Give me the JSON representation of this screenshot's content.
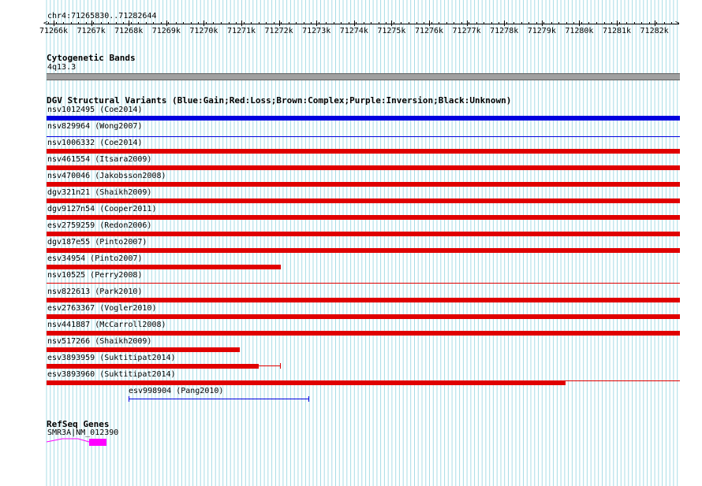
{
  "ruler": {
    "position_label": "chr4:71265830..71282644",
    "ticks": [
      "71266k",
      "71267k",
      "71268k",
      "71269k",
      "71270k",
      "71271k",
      "71272k",
      "71273k",
      "71274k",
      "71275k",
      "71276k",
      "71277k",
      "71278k",
      "71279k",
      "71280k",
      "71281k",
      "71282k"
    ]
  },
  "cytoband": {
    "title": "Cytogenetic Bands",
    "band_label": "4q13.3",
    "color": "#a0a0a0"
  },
  "dgv": {
    "title": "DGV Structural Variants (Blue:Gain;Red:Loss;Brown:Complex;Purple:Inversion;Black:Unknown)",
    "colors": {
      "gain": "#0000e0",
      "loss": "#e00000"
    },
    "variants": [
      {
        "label": "nsv1012495 (Coe2014)",
        "type": "gain"
      },
      {
        "label": "nsv829964 (Wong2007)",
        "type": "gain"
      },
      {
        "label": "nsv1006332 (Coe2014)",
        "type": "loss"
      },
      {
        "label": "nsv461554 (Itsara2009)",
        "type": "loss"
      },
      {
        "label": "nsv470046 (Jakobsson2008)",
        "type": "loss"
      },
      {
        "label": "dgv321n21 (Shaikh2009)",
        "type": "loss"
      },
      {
        "label": "dgv9127n54 (Cooper2011)",
        "type": "loss"
      },
      {
        "label": "esv2759259 (Redon2006)",
        "type": "loss"
      },
      {
        "label": "dgv187e55 (Pinto2007)",
        "type": "loss"
      },
      {
        "label": "esv34954 (Pinto2007)",
        "type": "loss"
      },
      {
        "label": "nsv10525 (Perry2008)",
        "type": "loss"
      },
      {
        "label": "nsv822613 (Park2010)",
        "type": "loss"
      },
      {
        "label": "esv2763367 (Vogler2010)",
        "type": "loss"
      },
      {
        "label": "nsv441887 (McCarroll2008)",
        "type": "loss"
      },
      {
        "label": "nsv517266 (Shaikh2009)",
        "type": "loss"
      },
      {
        "label": "esv3893959 (Suktitipat2014)",
        "type": "loss"
      },
      {
        "label": "esv3893960 (Suktitipat2014)",
        "type": "loss"
      },
      {
        "label": "esv998904 (Pang2010)",
        "type": "gain"
      }
    ]
  },
  "refseq": {
    "title": "RefSeq Genes",
    "gene_label": "SMR3A|NM_012390",
    "color": "#ff00ff"
  },
  "grid_color": "#a8dce6"
}
